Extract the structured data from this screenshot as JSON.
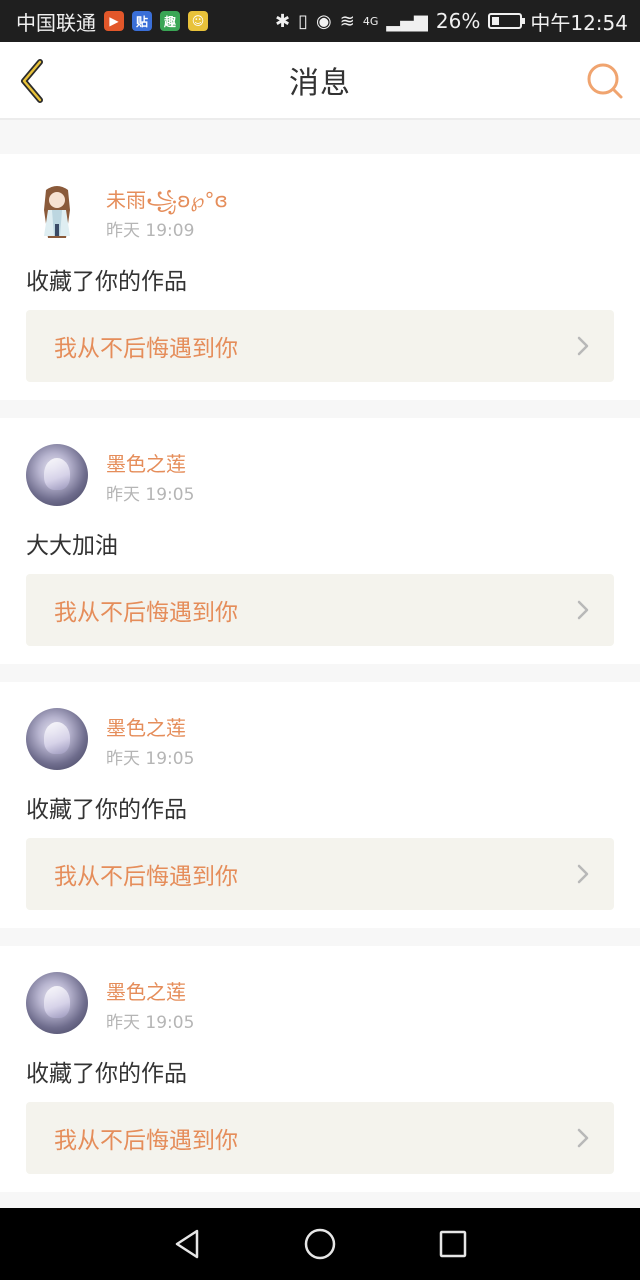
{
  "status_bar": {
    "carrier": "中国联通",
    "battery": "26%",
    "battery_level": 0.26,
    "network": "4G",
    "time": "中午12:54"
  },
  "header": {
    "title": "消息",
    "back_icon": "chevron-left-icon",
    "search_icon": "search-icon",
    "accent_color": "#e58d5a"
  },
  "messages": [
    {
      "username": "未雨꧁ʚ℘°ɞ",
      "time": "昨天 19:09",
      "action": "收藏了你的作品",
      "work": "我从不后悔遇到你"
    },
    {
      "username": "墨色之莲",
      "time": "昨天 19:05",
      "action": "大大加油",
      "work": "我从不后悔遇到你"
    },
    {
      "username": "墨色之莲",
      "time": "昨天 19:05",
      "action": "收藏了你的作品",
      "work": "我从不后悔遇到你"
    },
    {
      "username": "墨色之莲",
      "time": "昨天 19:05",
      "action": "收藏了你的作品",
      "work": "我从不后悔遇到你"
    }
  ],
  "nav_bar": {
    "back": "back-triangle-icon",
    "home": "home-circle-icon",
    "recents": "recents-square-icon"
  }
}
